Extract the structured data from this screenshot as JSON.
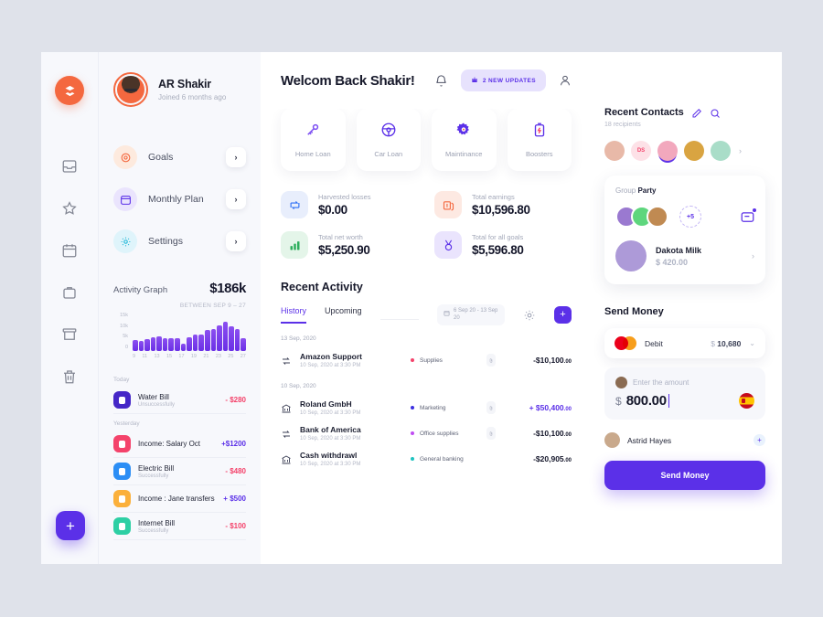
{
  "rail": {
    "logo_icon": "swirl-logo-icon",
    "icons": [
      "inbox-icon",
      "star-icon",
      "calendar-icon",
      "briefcase-icon",
      "archive-icon",
      "trash-icon"
    ],
    "fab_label": "+"
  },
  "profile": {
    "name": "AR Shakir",
    "meta": "Joined 6 months ago"
  },
  "menu": [
    {
      "label": "Goals",
      "icon": "target-icon",
      "bg": "#fdeade",
      "color": "#f4683f",
      "chevron": "›"
    },
    {
      "label": "Monthly Plan",
      "icon": "calendar-icon",
      "bg": "#eae4fd",
      "color": "#5b30e8",
      "chevron": "›"
    },
    {
      "label": "Settings",
      "icon": "gear-icon",
      "bg": "#dff4fb",
      "color": "#22b8d8",
      "chevron": "›"
    }
  ],
  "graph": {
    "title": "Activity Graph",
    "total": "$186k",
    "range": "BETWEEN SEP 9 – 27"
  },
  "chart_data": {
    "type": "bar",
    "title": "Activity Graph",
    "subtitle": "BETWEEN SEP 9 – 27",
    "total": "$186k",
    "xlabel": "",
    "ylabel": "",
    "ylim": [
      0,
      15000
    ],
    "yticks": [
      "0",
      "5k",
      "10k",
      "15k"
    ],
    "grid": false,
    "legend": "none",
    "categories": [
      "9",
      "10",
      "11",
      "12",
      "13",
      "14",
      "15",
      "16",
      "17",
      "18",
      "19",
      "20",
      "21",
      "22",
      "23",
      "24",
      "25",
      "26",
      "27"
    ],
    "xtick_labels": [
      "9",
      "11",
      "13",
      "15",
      "17",
      "19",
      "21",
      "23",
      "25",
      "27"
    ],
    "values": [
      4200,
      4000,
      4600,
      5200,
      5600,
      5000,
      4900,
      5100,
      2900,
      5400,
      6600,
      6500,
      8100,
      8700,
      10100,
      11600,
      9700,
      8500,
      5000
    ]
  },
  "transactions": {
    "groups": [
      {
        "day": "Today",
        "items": [
          {
            "name": "Water Bill",
            "status": "Unsuccessfully",
            "amount": "- $280",
            "amount_color": "#f4436b",
            "icon": "water-drop-icon",
            "icon_bg": "#4527c7"
          }
        ]
      },
      {
        "day": "Yesterday",
        "items": [
          {
            "name": "Income: Salary Oct",
            "status": "",
            "amount": "+$1200",
            "amount_color": "#5b30e8",
            "icon": "card-icon",
            "icon_bg": "#f4436b"
          },
          {
            "name": "Electric Bill",
            "status": "Successfully",
            "amount": "- $480",
            "amount_color": "#f4436b",
            "icon": "bolt-icon",
            "icon_bg": "#2c8ef5"
          },
          {
            "name": "Income : Jane transfers",
            "status": "",
            "amount": "+ $500",
            "amount_color": "#5b30e8",
            "icon": "wallet-icon",
            "icon_bg": "#fbb03b"
          },
          {
            "name": "Internet Bill",
            "status": "Successfully",
            "amount": "- $100",
            "amount_color": "#f4436b",
            "icon": "wifi-icon",
            "icon_bg": "#2dcfa4"
          }
        ]
      }
    ]
  },
  "header": {
    "welcome": "Welcom Back Shakir!",
    "bell_icon": "bell-icon",
    "updates_label": "2 NEW UPDATES",
    "updates_icon": "gift-icon",
    "user_icon": "user-icon"
  },
  "quick_actions": [
    {
      "label": "Home Loan",
      "icon": "key-icon",
      "color": "#7b4df2"
    },
    {
      "label": "Car Loan",
      "icon": "steering-wheel-icon",
      "color": "#5b30e8"
    },
    {
      "label": "Maintinance",
      "icon": "gear-icon",
      "color": "#5b30e8"
    },
    {
      "label": "Boosters",
      "icon": "battery-bolt-icon",
      "color": "#5b30e8"
    }
  ],
  "stats": [
    {
      "label": "Harvested losses",
      "value": "$0.00",
      "icon": "transfer-icon",
      "bg": "#e8eefc",
      "color": "#2c6ff5"
    },
    {
      "label": "Total earnings",
      "value": "$10,596.80",
      "icon": "money-icon",
      "bg": "#fde9e2",
      "color": "#f4683f"
    },
    {
      "label": "Total net worth",
      "value": "$5,250.90",
      "icon": "bar-chart-icon",
      "bg": "#e4f5e9",
      "color": "#2fae5e"
    },
    {
      "label": "Total for all goals",
      "value": "$5,596.80",
      "icon": "medal-icon",
      "bg": "#eae4fd",
      "color": "#5b30e8"
    }
  ],
  "activity": {
    "title": "Recent Activity",
    "tabs": [
      {
        "label": "History",
        "active": true
      },
      {
        "label": "Upcoming",
        "active": false
      }
    ],
    "date_range": "6 Sep 20 - 13 Sep 20",
    "calendar_icon": "calendar-icon",
    "gear_icon": "gear-icon",
    "add_label": "+",
    "groups": [
      {
        "day": "13 Sep, 2020",
        "rows": [
          {
            "icon": "transfer-arrows-icon",
            "name": "Amazon Support",
            "sub": "10 Sep, 2020 at 3:30 PM",
            "tag": "Supplies",
            "tag_color": "#f4436b",
            "has_clip": true,
            "amount": "-$10,100",
            "cents": ".00",
            "amount_color": "#14162a"
          }
        ]
      },
      {
        "day": "10 Sep, 2020",
        "rows": [
          {
            "icon": "bank-icon",
            "name": "Roland GmbH",
            "sub": "10 Sep, 2020 at 3:30 PM",
            "tag": "Marketing",
            "tag_color": "#3b2fe0",
            "has_clip": true,
            "amount": "+ $50,400",
            "cents": ".00",
            "amount_color": "#5b30e8"
          },
          {
            "icon": "transfer-arrows-icon",
            "name": "Bank of America",
            "sub": "10 Sep, 2020 at 3:30 PM",
            "tag": "Office supplies",
            "tag_color": "#c04df2",
            "has_clip": true,
            "amount": "-$10,100",
            "cents": ".00",
            "amount_color": "#14162a"
          },
          {
            "icon": "bank-icon",
            "name": "Cash withdrawl",
            "sub": "10 Sep, 2020 at 3:30 PM",
            "tag": "General banking",
            "tag_color": "#1fc3c0",
            "has_clip": false,
            "amount": "-$20,905",
            "cents": ".00",
            "amount_color": "#14162a"
          }
        ]
      }
    ]
  },
  "contacts": {
    "title": "Recent Contacts",
    "subtitle": "18 recipients",
    "edit_icon": "pencil-icon",
    "search_icon": "search-icon",
    "next_icon": "›",
    "avatars": [
      {
        "initials": "",
        "bg": "#e8b9a8",
        "selected": false
      },
      {
        "initials": "DS",
        "bg": "#fde1e7",
        "fg": "#f4436b",
        "selected": false
      },
      {
        "initials": "",
        "bg": "#f2a8bd",
        "selected": true
      },
      {
        "initials": "",
        "bg": "#d9a441",
        "selected": false
      },
      {
        "initials": "",
        "bg": "#a9ddc8",
        "selected": false
      }
    ]
  },
  "group": {
    "label_prefix": "Group",
    "label_name": "Party",
    "members": [
      {
        "bg": "#9a79d0"
      },
      {
        "bg": "#5ed67d"
      },
      {
        "bg": "#c08a52"
      }
    ],
    "more": "+5",
    "chat_icon": "chat-icon",
    "contact": {
      "name": "Dakota Milk",
      "amount": "$ 420.00",
      "arrow": "›"
    }
  },
  "send_money": {
    "title": "Send Money",
    "card": {
      "brand_icon": "mastercard-icon",
      "name": "Debit",
      "currency": "$",
      "balance": "10,680",
      "chevron": "⌄"
    },
    "amount": {
      "placeholder": "Enter the amount",
      "currency": "$",
      "value": "800.00",
      "flag_icon": "spain-flag-icon"
    },
    "recipient": {
      "name": "Astrid Hayes",
      "add_label": "+"
    },
    "button_label": "Send Money"
  }
}
